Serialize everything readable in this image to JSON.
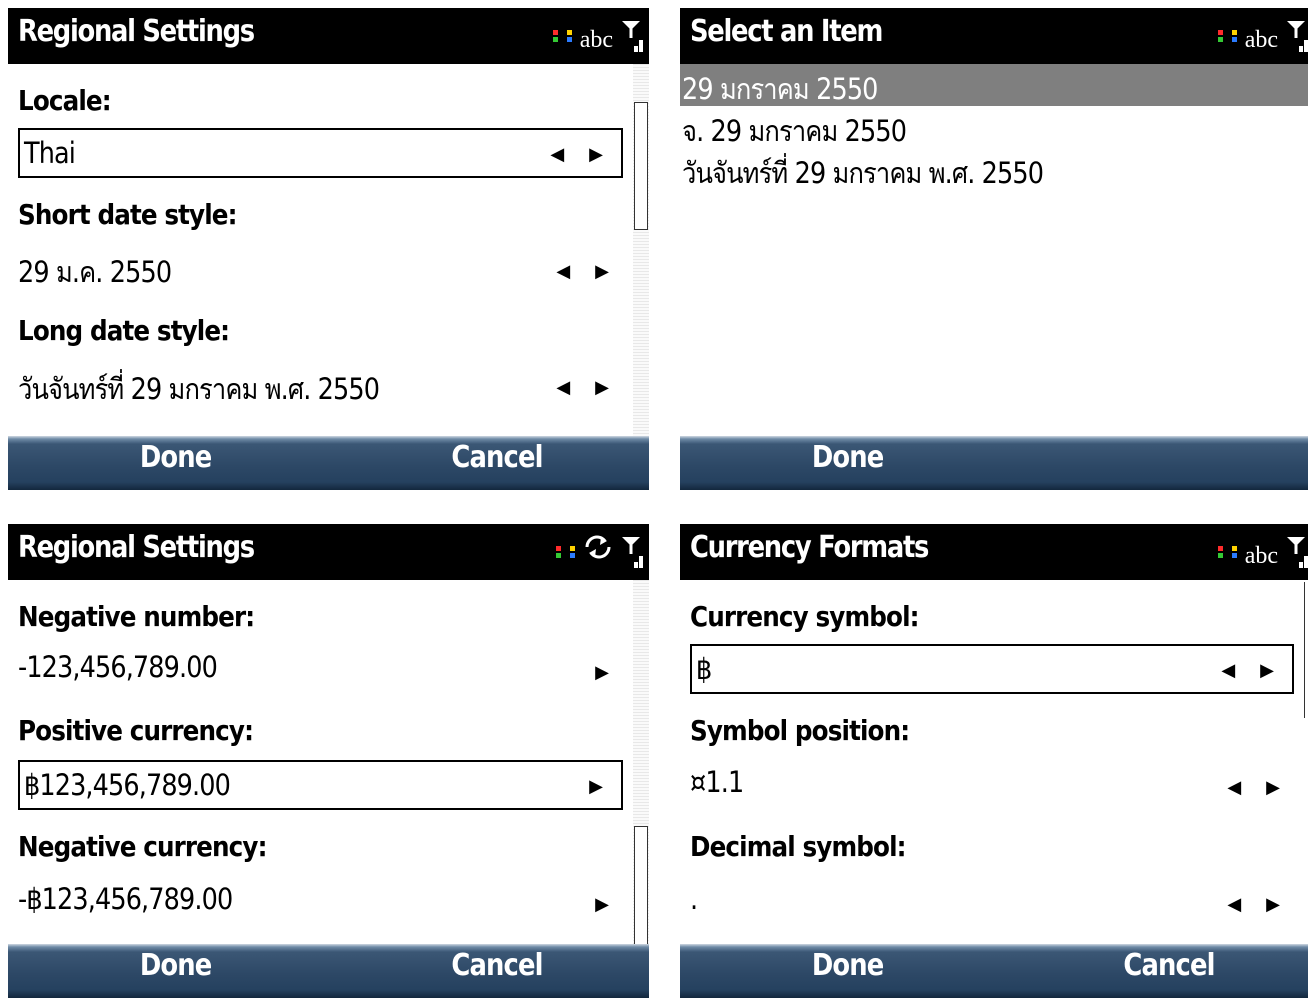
{
  "status_colors": [
    "#ff2b2b",
    "#ffd200",
    "#34c934",
    "#2b7bff"
  ],
  "panels": [
    {
      "title": "Regional Settings",
      "indicator": "abc",
      "fields": [
        {
          "label": "Locale:",
          "value": "Thai",
          "arrows": "◀ ▶"
        },
        {
          "label": "Short date style:",
          "value": "29 ม.ค. 2550",
          "arrows": "◀ ▶"
        },
        {
          "label": "Long date style:",
          "value": "วันจันทร์ที่ 29 มกราคม พ.ศ. 2550",
          "arrows": "◀ ▶"
        }
      ],
      "left_soft": "Done",
      "right_soft": "Cancel"
    },
    {
      "title": "Select an Item",
      "indicator": "abc",
      "items": [
        "29 มกราคม 2550",
        "จ. 29 มกราคม 2550",
        "วันจันทร์ที่ 29 มกราคม พ.ศ. 2550"
      ],
      "left_soft": "Done"
    },
    {
      "title": "Regional Settings",
      "fields": [
        {
          "label": "Negative number:",
          "value": "-123,456,789.00",
          "arrows": "▶"
        },
        {
          "label": "Positive currency:",
          "value": "฿123,456,789.00",
          "arrows": "▶"
        },
        {
          "label": "Negative currency:",
          "value": "-฿123,456,789.00",
          "arrows": "▶"
        }
      ],
      "left_soft": "Done",
      "right_soft": "Cancel"
    },
    {
      "title": "Currency Formats",
      "indicator": "abc",
      "fields": [
        {
          "label": "Currency symbol:",
          "value": "฿",
          "arrows": "◀ ▶"
        },
        {
          "label": "Symbol position:",
          "value": "¤1.1",
          "arrows": "◀ ▶"
        },
        {
          "label": "Decimal symbol:",
          "value": ".",
          "arrows": "◀ ▶"
        }
      ],
      "left_soft": "Done",
      "right_soft": "Cancel"
    }
  ]
}
